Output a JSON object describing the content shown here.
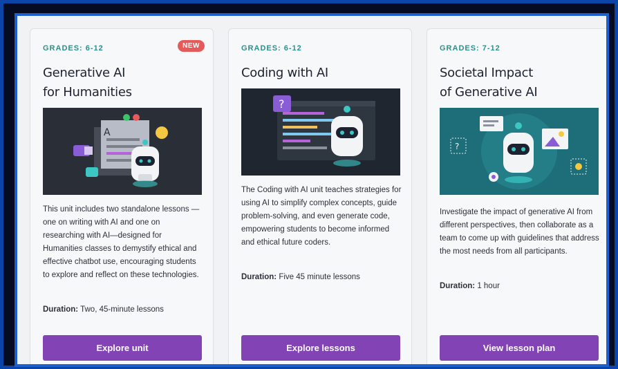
{
  "cards": [
    {
      "grades": "GRADES: 6-12",
      "badge": "NEW",
      "title_line1": "Generative AI",
      "title_line2": "for Humanities",
      "description": "This unit includes two standalone lessons — one on writing with AI and one on researching with AI—designed for Humanities classes to demystify ethical and effective chatbot use, encouraging students to explore and reflect on these technologies.",
      "duration_label": "Duration:",
      "duration_value": "Two, 45-minute lessons",
      "button": "Explore unit",
      "illustration_icon": "robot-with-document-icon",
      "illustration_text": "A"
    },
    {
      "grades": "GRADES: 6-12",
      "title_line1": "Coding with AI",
      "description": "The Coding with AI unit teaches strategies for using AI to simplify complex concepts, guide problem-solving, and even generate code, empowering students to become informed and ethical future coders.",
      "duration_label": "Duration:",
      "duration_value": "Five 45 minute lessons",
      "button": "Explore lessons",
      "illustration_icon": "robot-with-code-editor-icon",
      "illustration_text": "?"
    },
    {
      "grades": "GRADES: 7-12",
      "title_line1": "Societal Impact",
      "title_line2": "of Generative AI",
      "description": "Investigate the impact of generative AI from different perspectives, then collaborate as a team to come up with guidelines that address the most needs from all participants.",
      "duration_label": "Duration:",
      "duration_value": "1 hour",
      "button": "View lesson plan",
      "illustration_icon": "robot-with-network-icon",
      "illustration_text": "?"
    }
  ],
  "colors": {
    "accent_button": "#8243b5",
    "grades_teal": "#2e8f8a",
    "badge_red": "#e55b5b"
  }
}
